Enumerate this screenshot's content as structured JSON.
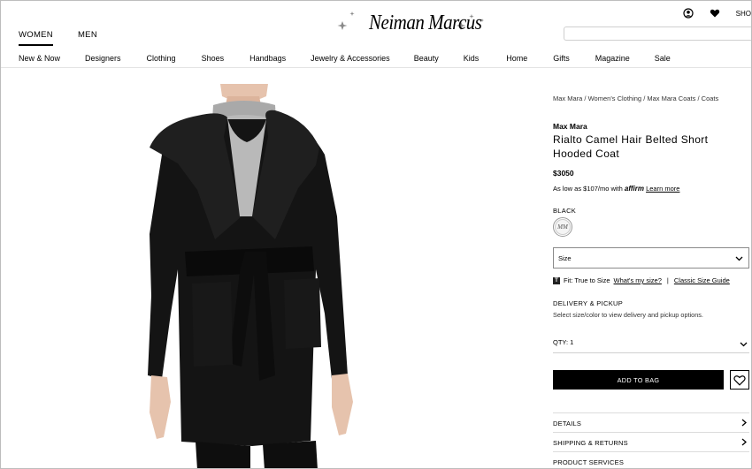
{
  "header": {
    "top_tabs": [
      "WOMEN",
      "MEN"
    ],
    "active_tab": "WOMEN",
    "logo_text": "Neiman Marcus",
    "right_partial": "SHO",
    "search_placeholder": ""
  },
  "nav": [
    "New & Now",
    "Designers",
    "Clothing",
    "Shoes",
    "Handbags",
    "Jewelry & Accessories",
    "Beauty",
    "Kids",
    "Home",
    "Gifts",
    "Magazine",
    "Sale"
  ],
  "breadcrumb": [
    "Max Mara",
    "Women's Clothing",
    "Max Mara Coats",
    "Coats"
  ],
  "breadcrumb_sep": " / ",
  "product": {
    "designer": "Max Mara",
    "title": "Rialto Camel Hair Belted Short Hooded Coat",
    "price": "$3050",
    "affirm_prefix": "As low as $107/mo with",
    "affirm_brand": "affirm",
    "affirm_link": "Learn more",
    "color_label": "BLACK",
    "swatch_text": "MM",
    "size_placeholder": "Size",
    "fit_icon": "T",
    "fit_text": "Fit: True to Size",
    "fit_link_1": "What's my size?",
    "fit_sep": "|",
    "fit_link_2": "Classic Size Guide",
    "delivery_title": "DELIVERY & PICKUP",
    "delivery_text": "Select size/color to view delivery and pickup options.",
    "qty_label": "QTY: 1",
    "add_to_bag": "ADD TO BAG",
    "accordions": [
      "DETAILS",
      "SHIPPING & RETURNS",
      "PRODUCT SERVICES"
    ]
  },
  "colors": {
    "accent": "#000000",
    "divider": "#dcdcdc",
    "coat": "#141414",
    "sweater": "#b9b9b9",
    "skin": "#e6c3ad"
  }
}
